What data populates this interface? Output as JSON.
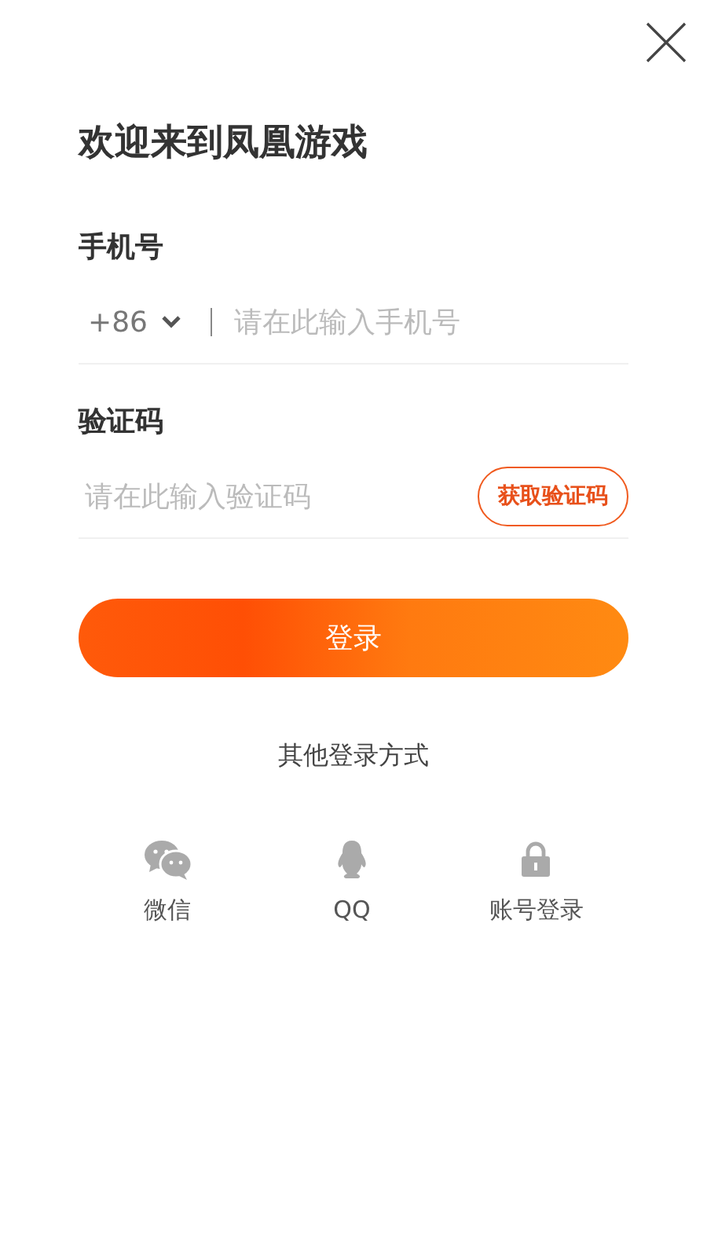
{
  "title": "欢迎来到凤凰游戏",
  "phone": {
    "label": "手机号",
    "country_code": "+86",
    "placeholder": "请在此输入手机号"
  },
  "code": {
    "label": "验证码",
    "placeholder": "请在此输入验证码",
    "send_button": "获取验证码"
  },
  "login_button": "登录",
  "other_login": {
    "title": "其他登录方式",
    "options": [
      {
        "kind": "wechat",
        "label": "微信"
      },
      {
        "kind": "qq",
        "label": "QQ"
      },
      {
        "kind": "account",
        "label": "账号登录"
      }
    ]
  }
}
